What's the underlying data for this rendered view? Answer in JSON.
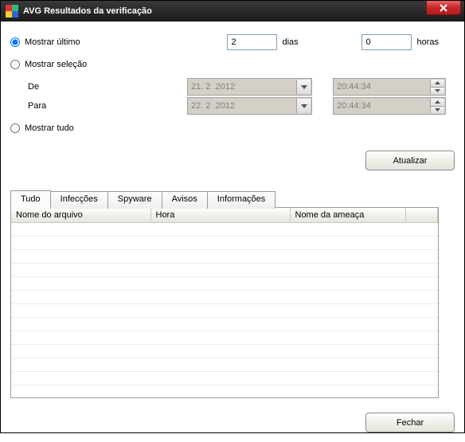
{
  "window": {
    "title": "AVG Resultados da verificação"
  },
  "filter": {
    "show_last_label": "Mostrar último",
    "show_selection_label": "Mostrar seleção",
    "show_all_label": "Mostrar tudo",
    "days_value": "2",
    "days_unit": "dias",
    "hours_value": "0",
    "hours_unit": "horas",
    "from_label": "De",
    "to_label": "Para",
    "from_date": "21. 2 .2012",
    "from_time": "20:44:34",
    "to_date": "22. 2 .2012",
    "to_time": "20:44:34"
  },
  "buttons": {
    "update": "Atualizar",
    "close": "Fechar"
  },
  "tabs": {
    "t0": "Tudo",
    "t1": "Infecções",
    "t2": "Spyware",
    "t3": "Avisos",
    "t4": "Informações"
  },
  "columns": {
    "c0": "Nome do arquivo",
    "c1": "Hora",
    "c2": "Nome da ameaça"
  }
}
